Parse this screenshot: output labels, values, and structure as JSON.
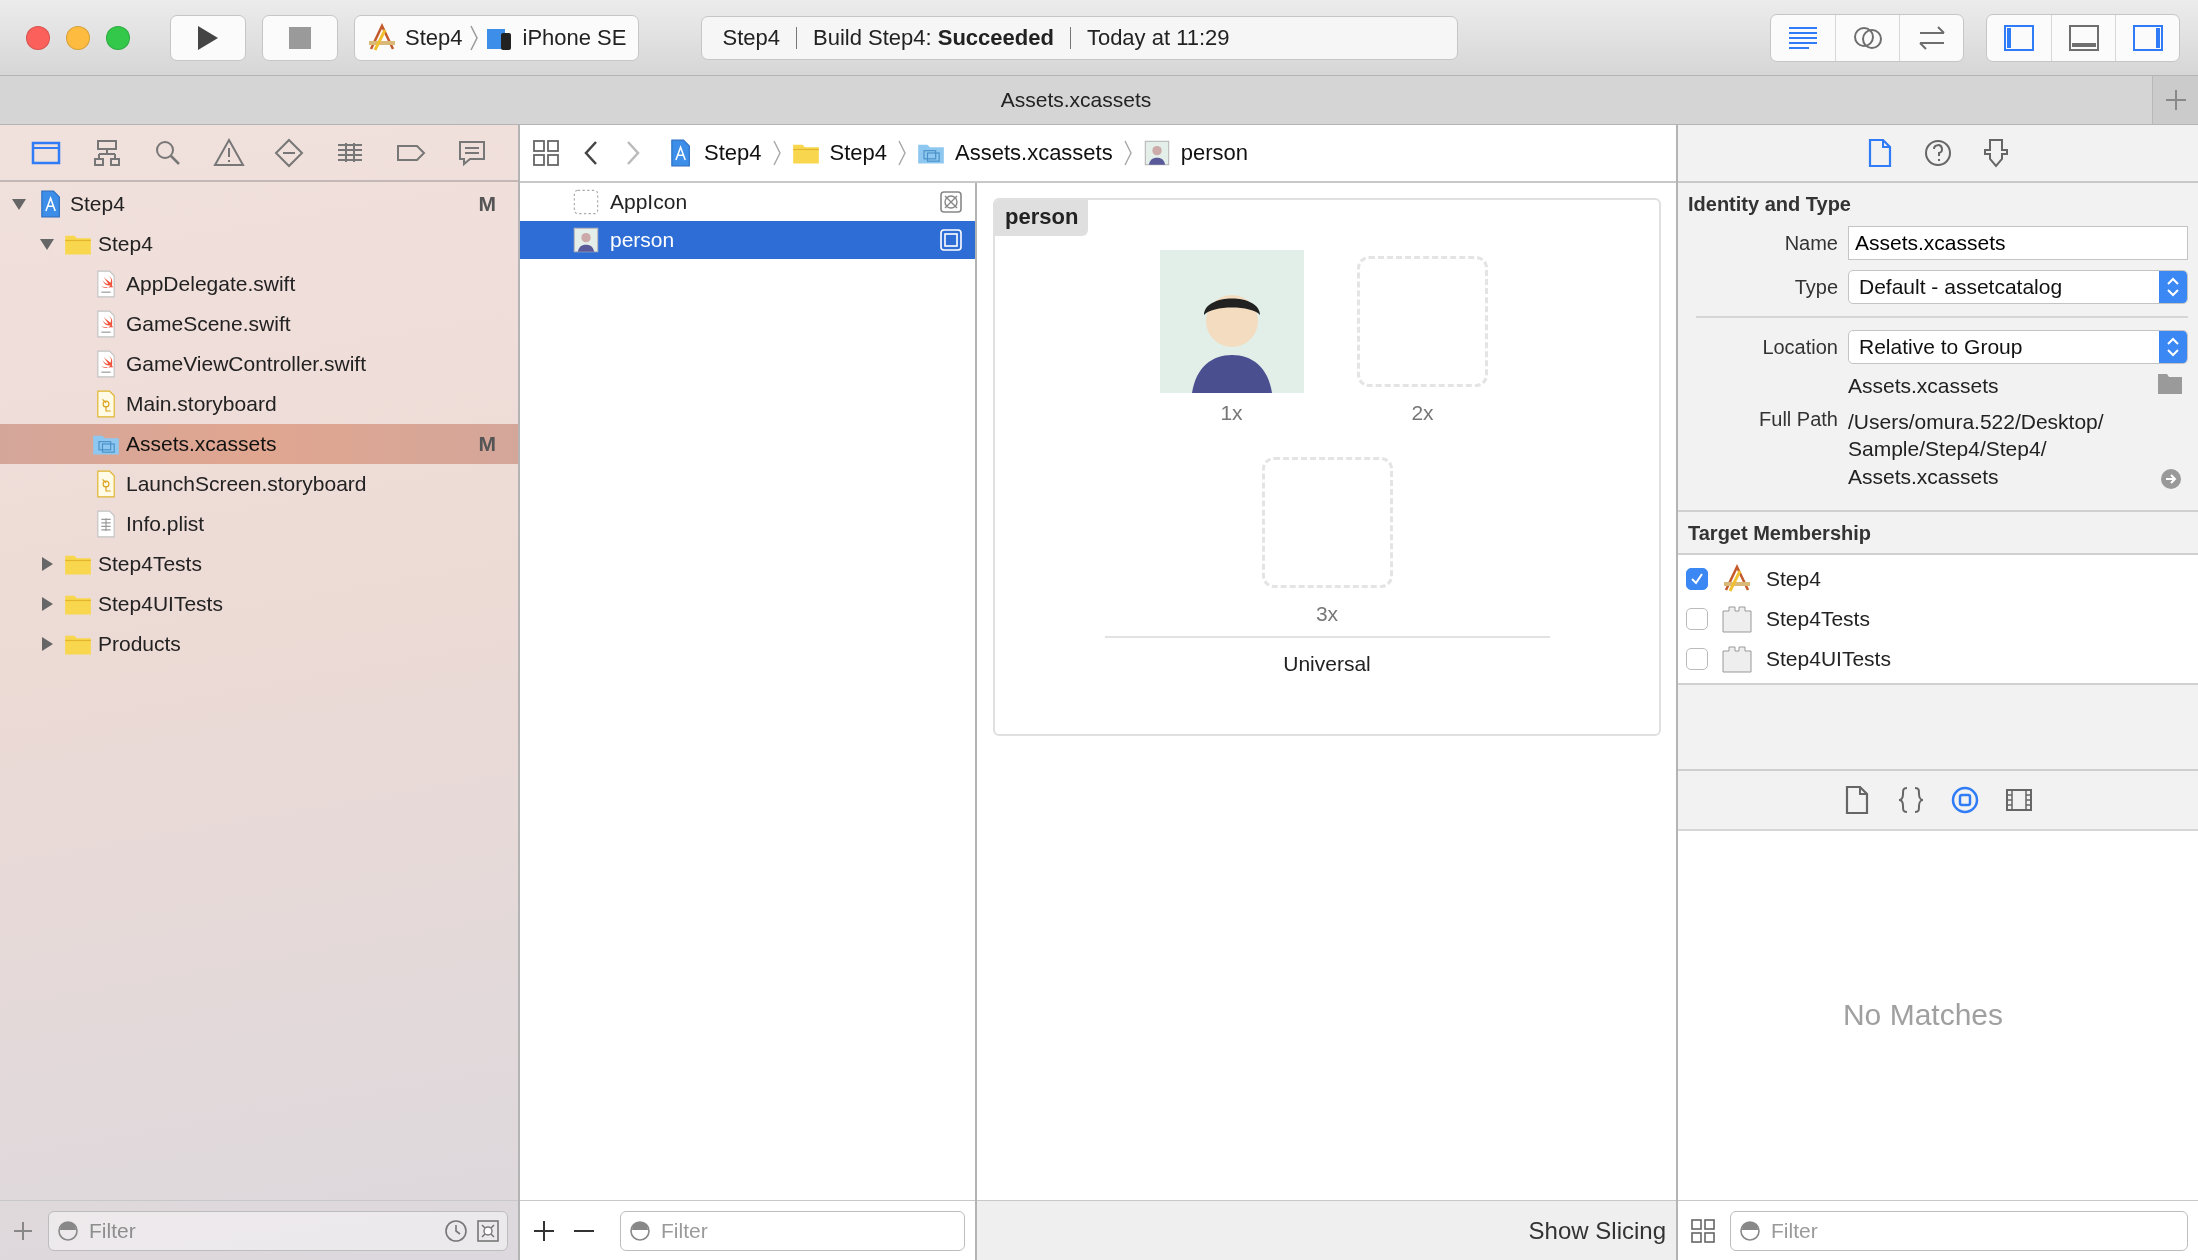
{
  "toolbar": {
    "scheme": "Step4",
    "device": "iPhone SE",
    "activity": {
      "project": "Step4",
      "status": "Build Step4: **Succeeded**",
      "time": "Today at 11:29"
    },
    "editor_modes": [
      {
        "kind": "standard",
        "selected": true
      },
      {
        "kind": "assistant",
        "selected": false
      },
      {
        "kind": "version",
        "selected": false
      }
    ],
    "panels": [
      {
        "kind": "navigator",
        "on": true
      },
      {
        "kind": "debug",
        "on": false
      },
      {
        "kind": "utilities",
        "on": true
      }
    ]
  },
  "tab_bar": {
    "title": "Assets.xcassets"
  },
  "navigator": {
    "tabs": [
      {
        "kind": "project",
        "selected": true
      },
      {
        "kind": "symbol",
        "selected": false
      },
      {
        "kind": "find",
        "selected": false
      },
      {
        "kind": "issue",
        "selected": false
      },
      {
        "kind": "test",
        "selected": false
      },
      {
        "kind": "debug",
        "selected": false
      },
      {
        "kind": "breakpoint",
        "selected": false
      },
      {
        "kind": "report",
        "selected": false
      }
    ],
    "tree": [
      {
        "name": "Step4",
        "kind": "project",
        "badge": "M",
        "expanded": true,
        "selected": false,
        "children": [
          {
            "name": "Step4",
            "kind": "folder",
            "expanded": true,
            "selected": false,
            "children": [
              {
                "name": "AppDelegate.swift",
                "kind": "swift",
                "selected": false
              },
              {
                "name": "GameScene.swift",
                "kind": "swift",
                "selected": false
              },
              {
                "name": "GameViewController.swift",
                "kind": "swift",
                "selected": false
              },
              {
                "name": "Main.storyboard",
                "kind": "storyboard",
                "selected": false
              },
              {
                "name": "Assets.xcassets",
                "kind": "assets",
                "badge": "M",
                "selected": true
              },
              {
                "name": "LaunchScreen.storyboard",
                "kind": "storyboard",
                "selected": false
              },
              {
                "name": "Info.plist",
                "kind": "plist",
                "selected": false
              }
            ]
          },
          {
            "name": "Step4Tests",
            "kind": "folder",
            "expanded": false,
            "selected": false
          },
          {
            "name": "Step4UITests",
            "kind": "folder",
            "expanded": false,
            "selected": false
          },
          {
            "name": "Products",
            "kind": "folder",
            "expanded": false,
            "selected": false
          }
        ]
      }
    ],
    "filter": {
      "placeholder": "Filter"
    }
  },
  "jump_bar": {
    "back_enabled": true,
    "forward_enabled": false,
    "path": [
      {
        "label": "Step4",
        "kind": "project"
      },
      {
        "label": "Step4",
        "kind": "folder"
      },
      {
        "label": "Assets.xcassets",
        "kind": "assets"
      },
      {
        "label": "person",
        "kind": "image"
      }
    ]
  },
  "asset_list": {
    "items": [
      {
        "name": "AppIcon",
        "kind": "appicon",
        "selected": false
      },
      {
        "name": "person",
        "kind": "image",
        "selected": true
      }
    ],
    "filter": {
      "placeholder": "Filter"
    }
  },
  "editor": {
    "set_name": "person",
    "slots": [
      {
        "label": "1x",
        "filled": true
      },
      {
        "label": "2x",
        "filled": false
      },
      {
        "label": "3x",
        "filled": false
      }
    ],
    "device_label": "Universal",
    "show_slicing": "Show Slicing"
  },
  "inspector": {
    "tabs": [
      {
        "kind": "file",
        "selected": true
      },
      {
        "kind": "help",
        "selected": false
      },
      {
        "kind": "identity",
        "selected": false
      }
    ],
    "identity": {
      "title": "Identity and Type",
      "name_label": "Name",
      "name": "Assets.xcassets",
      "type_label": "Type",
      "type": "Default - assetcatalog",
      "location_label": "Location",
      "location": "Relative to Group",
      "location_file": "Assets.xcassets",
      "full_path_label": "Full Path",
      "full_path": "/Users/omura.522/Desktop/Sample/Step4/Step4/Assets.xcassets"
    },
    "membership": {
      "title": "Target Membership",
      "targets": [
        {
          "name": "Step4",
          "kind": "app",
          "checked": true
        },
        {
          "name": "Step4Tests",
          "kind": "bundle",
          "checked": false
        },
        {
          "name": "Step4UITests",
          "kind": "bundle",
          "checked": false
        }
      ]
    }
  },
  "library": {
    "tabs": [
      {
        "kind": "file",
        "selected": false
      },
      {
        "kind": "code",
        "selected": false
      },
      {
        "kind": "object",
        "selected": true
      },
      {
        "kind": "media",
        "selected": false
      }
    ],
    "empty_text": "No Matches",
    "filter": {
      "placeholder": "Filter"
    }
  }
}
